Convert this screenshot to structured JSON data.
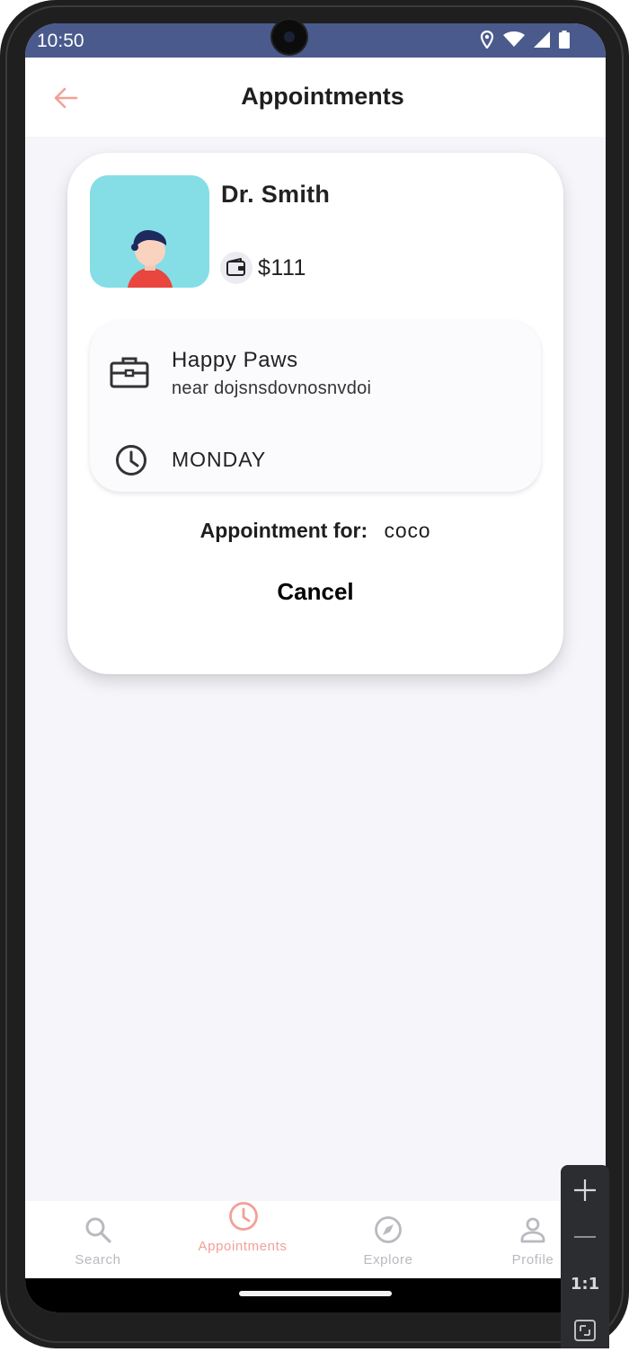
{
  "status_bar": {
    "time": "10:50"
  },
  "app_bar": {
    "title": "Appointments"
  },
  "appointment": {
    "doctor_name": "Dr. Smith",
    "fee": "$111",
    "clinic_name": "Happy Paws",
    "clinic_address": "near dojsnsdovnosnvdoi",
    "day": "MONDAY",
    "for_label": "Appointment for:",
    "for_value": "coco",
    "cancel_label": "Cancel"
  },
  "bottom_nav": {
    "items": [
      {
        "label": "Search",
        "icon": "search-icon"
      },
      {
        "label": "Appointments",
        "icon": "clock-icon"
      },
      {
        "label": "Explore",
        "icon": "compass-icon"
      },
      {
        "label": "Profile",
        "icon": "person-icon"
      }
    ],
    "active_index": 1,
    "active_color": "#f2a097",
    "inactive_color": "#b9b9c0"
  },
  "emulator_controls": {
    "zoom_reset_label": "1:1"
  },
  "colors": {
    "status_bar": "#4a5a8c",
    "accent": "#f2a097",
    "avatar_bg": "#85dde6",
    "page_bg": "#f5f5fa"
  }
}
